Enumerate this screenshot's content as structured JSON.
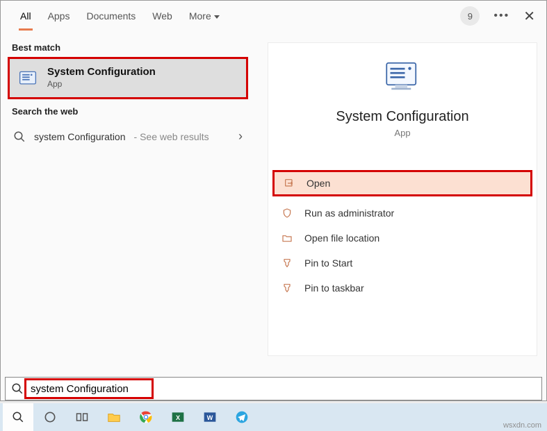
{
  "tabs": {
    "all": "All",
    "apps": "Apps",
    "documents": "Documents",
    "web": "Web",
    "more": "More"
  },
  "badge": "9",
  "sections": {
    "bestMatch": "Best match",
    "searchWeb": "Search the web"
  },
  "bestMatch": {
    "title": "System Configuration",
    "sub": "App"
  },
  "webResult": {
    "query": "system Configuration",
    "hint": "See web results"
  },
  "preview": {
    "title": "System Configuration",
    "sub": "App"
  },
  "actions": {
    "open": "Open",
    "runAdmin": "Run as administrator",
    "openLoc": "Open file location",
    "pinStart": "Pin to Start",
    "pinTaskbar": "Pin to taskbar"
  },
  "search": {
    "value": "system Configuration"
  },
  "watermark": "wsxdn.com"
}
